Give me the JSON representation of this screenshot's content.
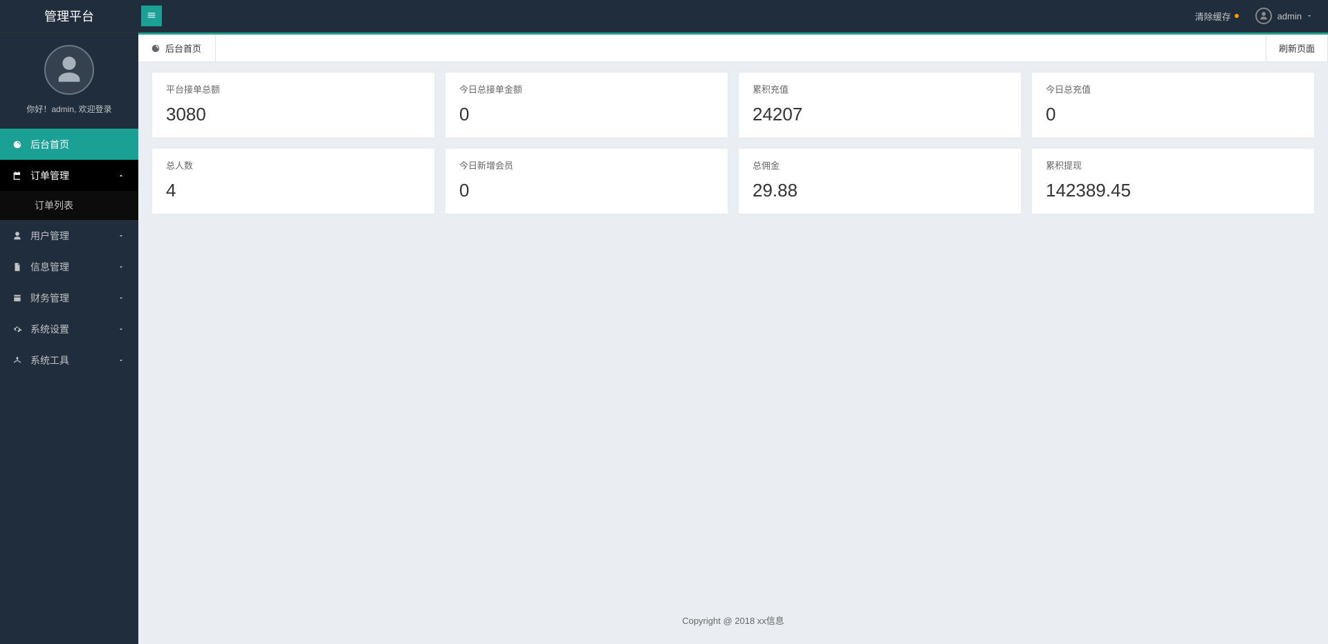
{
  "header": {
    "logo": "管理平台",
    "clearCache": "清除缓存",
    "username": "admin"
  },
  "sidebar": {
    "welcome": "你好！admin, 欢迎登录",
    "menu": [
      {
        "label": "后台首页",
        "name": "home",
        "icon": "dashboard",
        "type": "item",
        "active": true
      },
      {
        "label": "订单管理",
        "name": "order",
        "icon": "calendar",
        "type": "group",
        "expanded": true,
        "children": [
          {
            "label": "订单列表",
            "name": "order-list"
          }
        ]
      },
      {
        "label": "用户管理",
        "name": "user",
        "icon": "user",
        "type": "group",
        "expanded": false
      },
      {
        "label": "信息管理",
        "name": "info",
        "icon": "file",
        "type": "group",
        "expanded": false
      },
      {
        "label": "财务管理",
        "name": "finance",
        "icon": "money",
        "type": "group",
        "expanded": false
      },
      {
        "label": "系统设置",
        "name": "settings",
        "icon": "gear",
        "type": "group",
        "expanded": false
      },
      {
        "label": "系统工具",
        "name": "tools",
        "icon": "wrench",
        "type": "group",
        "expanded": false
      }
    ]
  },
  "tabs": {
    "current": "后台首页",
    "refresh": "刷新页面"
  },
  "stats": [
    {
      "label": "平台接单总额",
      "value": "3080",
      "name": "total-order-amount"
    },
    {
      "label": "今日总接单金额",
      "value": "0",
      "name": "today-order-amount"
    },
    {
      "label": "累积充值",
      "value": "24207",
      "name": "total-recharge"
    },
    {
      "label": "今日总充值",
      "value": "0",
      "name": "today-recharge"
    },
    {
      "label": "总人数",
      "value": "4",
      "name": "total-users"
    },
    {
      "label": "今日新增会员",
      "value": "0",
      "name": "today-new-users"
    },
    {
      "label": "总佣金",
      "value": "29.88",
      "name": "total-commission"
    },
    {
      "label": "累积提现",
      "value": "142389.45",
      "name": "total-withdraw"
    }
  ],
  "footer": "Copyright @ 2018 xx信息"
}
